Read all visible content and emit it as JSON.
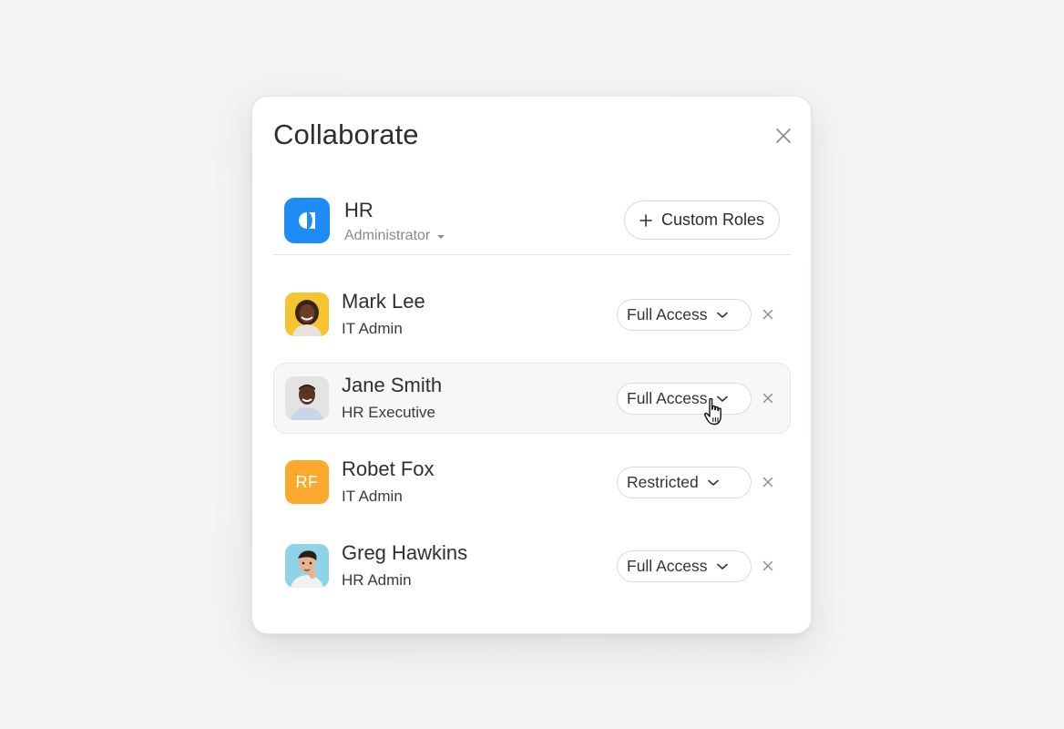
{
  "modal": {
    "title": "Collaborate"
  },
  "organization": {
    "name": "HR",
    "role": "Administrator",
    "custom_roles_label": "Custom Roles",
    "logo_color": "#1e8cf5"
  },
  "members": [
    {
      "name": "Mark Lee",
      "role": "IT Admin",
      "access": "Full Access",
      "avatar": "photo-woman-smiling"
    },
    {
      "name": "Jane Smith",
      "role": "HR Executive",
      "access": "Full Access",
      "avatar": "photo-man-smiling"
    },
    {
      "name": "Robet Fox",
      "role": "IT Admin",
      "access": "Restricted",
      "avatar_initials": "RF",
      "avatar_color": "#ffa82e"
    },
    {
      "name": "Greg Hawkins",
      "role": "HR Admin",
      "access": "Full Access",
      "avatar": "photo-man-thinking"
    }
  ],
  "icons": {
    "close": "close-icon",
    "plus": "plus-icon",
    "dropdown": "chevron-down-icon",
    "remove": "remove-icon",
    "cursor": "pointer-hand-icon"
  }
}
